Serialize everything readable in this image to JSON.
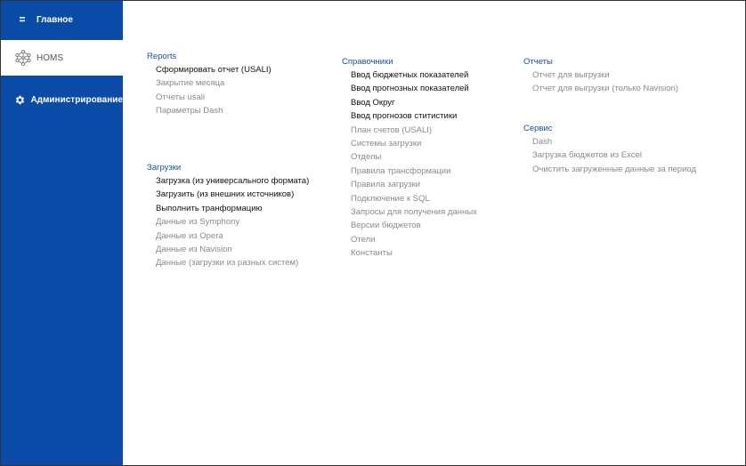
{
  "sidebar": {
    "main_label": "Главное",
    "homs_label": "HOMS",
    "admin_label": "Администрирование",
    "color": "#0a4ba8"
  },
  "col1": {
    "reports": {
      "title": "Reports",
      "items": [
        {
          "label": "Сформировать отчет (USALI)",
          "active": true
        },
        {
          "label": "Закрытие месяца",
          "active": false
        },
        {
          "label": "Отчеты usali",
          "active": false
        },
        {
          "label": "Параметры Dash",
          "active": false
        }
      ]
    },
    "loads": {
      "title": "Загрузки",
      "items": [
        {
          "label": "Загрузка (из универсального формата)",
          "active": true
        },
        {
          "label": "Загрузить (из внешних источников)",
          "active": true
        },
        {
          "label": "Выполнить транформацию",
          "active": true
        },
        {
          "label": "Данные из Symphony",
          "active": false
        },
        {
          "label": "Данные из Opera",
          "active": false
        },
        {
          "label": "Данные из Navision",
          "active": false
        },
        {
          "label": "Данные (загрузки из разных систем)",
          "active": false
        }
      ]
    }
  },
  "col2": {
    "refs": {
      "title": "Справочники",
      "items": [
        {
          "label": "Ввод бюджетных показателей",
          "active": true
        },
        {
          "label": "Ввод прогнозных показателей",
          "active": true
        },
        {
          "label": "Ввод Округ",
          "active": true
        },
        {
          "label": "Ввод прогнозов ститистики",
          "active": true
        },
        {
          "label": "План счетов (USALI)",
          "active": false
        },
        {
          "label": "Системы загрузки",
          "active": false
        },
        {
          "label": "Отделы",
          "active": false
        },
        {
          "label": "Правила трансформации",
          "active": false
        },
        {
          "label": "Правила загрузки",
          "active": false
        },
        {
          "label": "Подключение к SQL",
          "active": false
        },
        {
          "label": "Запросы для получения данных",
          "active": false
        },
        {
          "label": "Версии бюджетов",
          "active": false
        },
        {
          "label": "Отели",
          "active": false
        },
        {
          "label": "Константы",
          "active": false
        }
      ]
    }
  },
  "col3": {
    "reports_ru": {
      "title": "Отчеты",
      "items": [
        {
          "label": "Отчет для выгрузки",
          "active": false
        },
        {
          "label": "Отчет для выгрузки (только Navision)",
          "active": false
        }
      ]
    },
    "service": {
      "title": "Сервис",
      "items": [
        {
          "label": "Dash",
          "active": false
        },
        {
          "label": "Загрузка бюджетов из Excel",
          "active": false
        },
        {
          "label": "Очистить загруженные данные за период",
          "active": false
        }
      ]
    }
  }
}
